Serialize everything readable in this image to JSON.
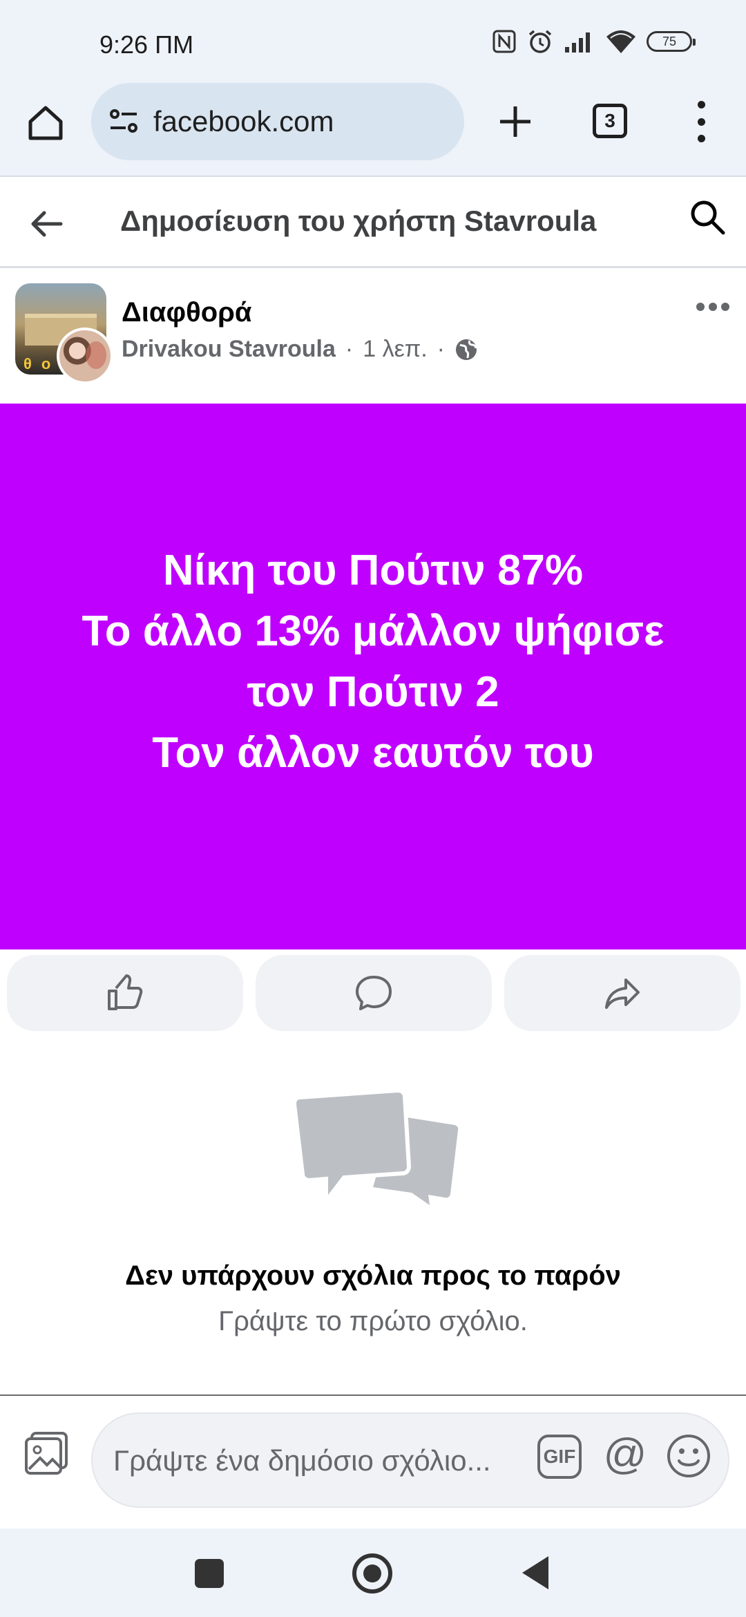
{
  "status_bar": {
    "time": "9:26 ΠΜ",
    "battery": "75",
    "icons": [
      "nfc-icon",
      "alarm-icon",
      "signal-icon",
      "wifi-icon",
      "battery-icon"
    ]
  },
  "browser": {
    "url": "facebook.com",
    "tab_count": "3"
  },
  "header": {
    "title": "Δημοσίευση του χρήστη Stavroula"
  },
  "post": {
    "group_name": "Διαφθορά",
    "author": "Drivakou Stavroula",
    "time": "1 λεπ.",
    "separator": "·",
    "background_color": "#bf00ff",
    "text_lines": [
      "Νίκη του Πούτιν 87%",
      "Το άλλο 13% μάλλον ψήφισε",
      "τον Πούτιν 2",
      "Τον άλλον εαυτόν του"
    ]
  },
  "comments": {
    "empty_title": "Δεν υπάρχουν σχόλια προς το παρόν",
    "empty_subtitle": "Γράψτε το πρώτο σχόλιο."
  },
  "composer": {
    "placeholder": "Γράψτε ένα δημόσιο σχόλιο...",
    "gif_label": "GIF",
    "mention_label": "@"
  }
}
